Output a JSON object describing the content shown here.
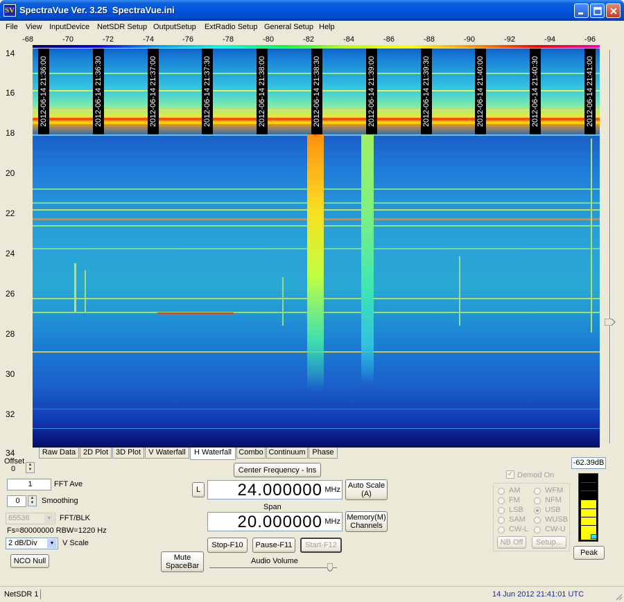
{
  "window": {
    "logo": "SV",
    "title": "SpectraVue Ver. 3.25  SpectraVue.ini"
  },
  "menu": [
    "File",
    "View",
    "InputDevice",
    "NetSDR Setup",
    "OutputSetup",
    "ExtRadio Setup",
    "General Setup",
    "Help"
  ],
  "x_axis": {
    "ticks": [
      "-68",
      "-70",
      "-72",
      "-74",
      "-76",
      "-78",
      "-80",
      "-82",
      "-84",
      "-86",
      "-88",
      "-90",
      "-92",
      "-94",
      "-96"
    ]
  },
  "y_axis": {
    "ticks": [
      "14",
      "16",
      "18",
      "20",
      "22",
      "24",
      "26",
      "28",
      "30",
      "32",
      "34"
    ]
  },
  "waterfall": {
    "timestamps": [
      "2012-06-14 21:36:00",
      "2012-06-14 21:36:30",
      "2012-06-14 21:37:00",
      "2012-06-14 21:37:30",
      "2012-06-14 21:38:00",
      "2012-06-14 21:38:30",
      "2012-06-14 21:39:00",
      "2012-06-14 21:39:30",
      "2012-06-14 21:40:00",
      "2012-06-14 21:40:30",
      "2012-06-14 21:41:00"
    ]
  },
  "tabs": [
    "Raw Data",
    "2D Plot",
    "3D Plot",
    "V Waterfall",
    "H Waterfall",
    "Combo",
    "Continuum",
    "Phase"
  ],
  "active_tab": "H Waterfall",
  "controls": {
    "offset_label": "Offset",
    "offset_value": "0",
    "fft_ave_value": "1",
    "fft_ave_label": "FFT Ave",
    "smoothing_value": "0",
    "smoothing_label": "Smoothing",
    "fft_blk_value": "65536",
    "fft_blk_label": "FFT/BLK",
    "fs_info": "Fs=80000000 RBW=1220 Hz",
    "vscale_value": "2 dB/Div",
    "vscale_label": "V Scale",
    "nco_null": "NCO Null",
    "center_freq_button": "Center Frequency - Ins",
    "l_button": "L",
    "center_freq_value": "24.000000",
    "center_freq_unit": "MHz",
    "auto_scale_line1": "Auto Scale",
    "auto_scale_line2": "(A)",
    "span_label": "Span",
    "span_value": "20.000000",
    "span_unit": "MHz",
    "memory_line1": "Memory(M)",
    "memory_line2": "Channels",
    "stop": "Stop-F10",
    "pause": "Pause-F11",
    "start": "Start-F12",
    "mute_line1": "Mute",
    "mute_line2": "SpaceBar",
    "audio_volume_label": "Audio Volume",
    "level_readout": "-62.39dB",
    "peak": "Peak"
  },
  "demod": {
    "label": "Demod On",
    "modes_left": [
      "AM",
      "FM",
      "LSB",
      "SAM",
      "CW-L"
    ],
    "modes_right": [
      "WFM",
      "NFM",
      "USB",
      "WUSB",
      "CW-U"
    ],
    "selected": "USB",
    "nb_off": "NB Off",
    "setup": "Setup..."
  },
  "status": {
    "left": "NetSDR 1",
    "right": "14 Jun 2012  21:41:01 UTC"
  },
  "colors": {
    "title_bar": "#0054e3",
    "status_text": "#1a2a90",
    "meter_fill": "#ffff00"
  }
}
